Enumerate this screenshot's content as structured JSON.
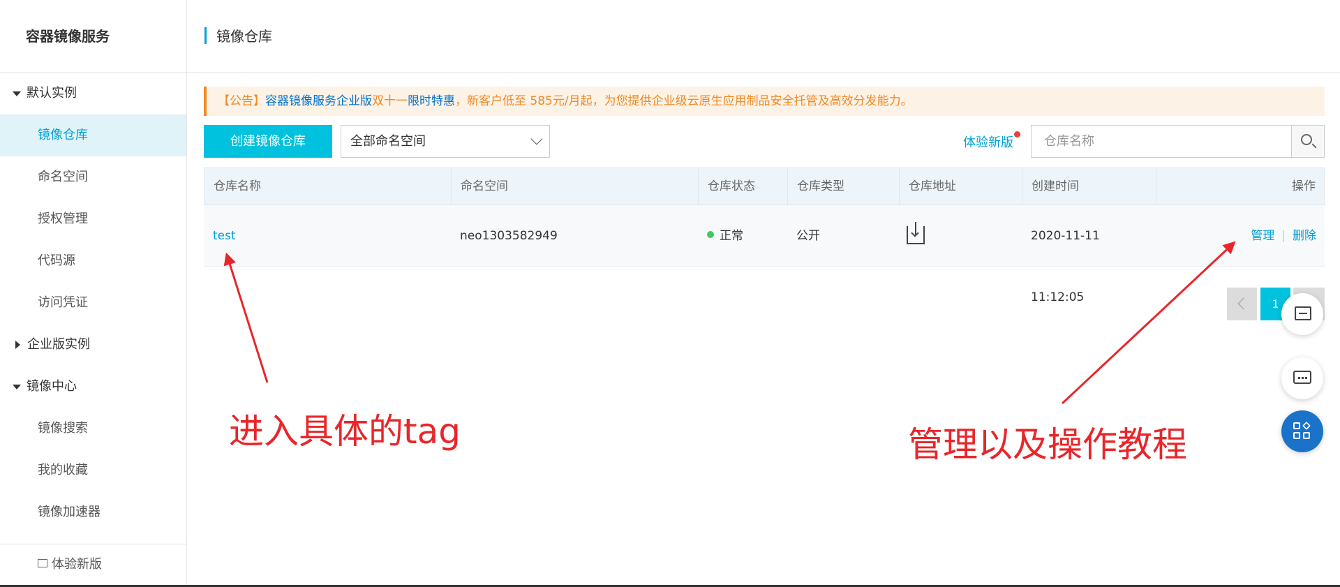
{
  "sidebar": {
    "title": "容器镜像服务",
    "group_default": "默认实例",
    "items_default": [
      "镜像仓库",
      "命名空间",
      "授权管理",
      "代码源",
      "访问凭证"
    ],
    "group_enterprise": "企业版实例",
    "group_center": "镜像中心",
    "items_center": [
      "镜像搜索",
      "我的收藏",
      "镜像加速器"
    ],
    "footer": "体验新版"
  },
  "header": {
    "title": "镜像仓库"
  },
  "notice": {
    "prefix": "【公告】",
    "link1": "容器镜像服务企业版",
    "mid": "双十一",
    "link2": "限时特惠",
    "rest": "，新客户低至 585元/月起，为您提供企业级云原生应用制品安全托管及高效分发能力。"
  },
  "toolbar": {
    "create_label": "创建镜像仓库",
    "namespace_select": "全部命名空间",
    "try_new": "体验新版",
    "search_placeholder": "仓库名称"
  },
  "table": {
    "headers": [
      "仓库名称",
      "命名空间",
      "仓库状态",
      "仓库类型",
      "仓库地址",
      "创建时间",
      "操作"
    ],
    "rows": [
      {
        "name": "test",
        "namespace": "neo1303582949",
        "status": "正常",
        "type": "公开",
        "created": "2020-11-11 11:12:05",
        "op_manage": "管理",
        "op_sep": "|",
        "op_delete": "删除"
      }
    ]
  },
  "pagination": {
    "current": "1"
  },
  "annotations": {
    "left": "进入具体的tag",
    "right": "管理以及操作教程"
  },
  "colors": {
    "accent": "#00c1de",
    "link": "#00a1d6",
    "annotation": "#e8262a",
    "notice": "#f08a24"
  }
}
